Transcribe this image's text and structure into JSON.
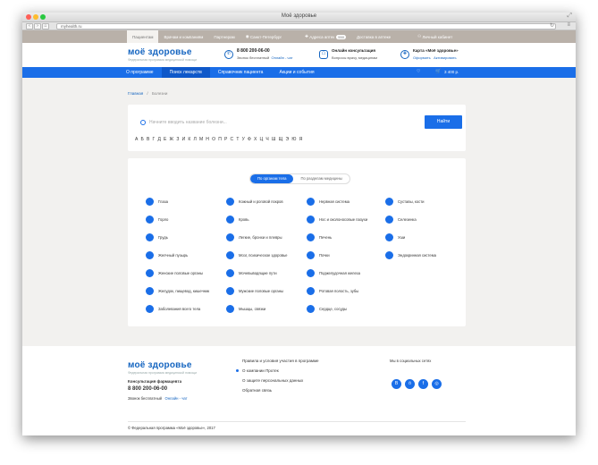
{
  "window": {
    "title": "Моё здоровье",
    "url": "myhealth.ru"
  },
  "topbar": {
    "items": [
      {
        "label": "Пациентам",
        "active": true
      },
      {
        "label": "Врачам и компаниям",
        "active": false
      },
      {
        "label": "Партнерам",
        "active": false
      },
      {
        "label": "Санкт-Петербург",
        "active": false
      },
      {
        "label": "Адреса аптек",
        "active": false,
        "badge": "550"
      },
      {
        "label": "Доставка в аптеке",
        "active": false
      },
      {
        "label": "Личный кабинет",
        "active": false
      }
    ]
  },
  "header": {
    "logo": "моё здоровье",
    "logo_sub": "Федеральная программа медицинской помощи",
    "phone": "8 800 200-06-00",
    "phone_note": "Звонок бесплатный",
    "phone_chat": "Онлайн - чат",
    "consult_title": "Онлайн консультация",
    "consult_sub": "Вопросы врачу, медицинам",
    "card_title": "Карта «Моё здоровье»",
    "card_link1": "Оформить",
    "card_link2": "Активировать"
  },
  "nav": {
    "items": [
      {
        "label": "О программе",
        "active": false
      },
      {
        "label": "Поиск лекарств",
        "active": true
      },
      {
        "label": "Справочник пациента",
        "active": false
      },
      {
        "label": "Акции и события",
        "active": false
      }
    ],
    "cart_total": "3 400 р."
  },
  "breadcrumb": {
    "home": "Главная",
    "current": "Болезни"
  },
  "search": {
    "placeholder": "Начните вводить название болезни...",
    "button": "Найти",
    "letters": [
      "А",
      "Б",
      "В",
      "Г",
      "Д",
      "Е",
      "Ж",
      "З",
      "И",
      "К",
      "Л",
      "М",
      "Н",
      "О",
      "П",
      "Р",
      "С",
      "Т",
      "У",
      "Ф",
      "Х",
      "Ц",
      "Ч",
      "Ш",
      "Щ",
      "Э",
      "Ю",
      "Я"
    ]
  },
  "tabs": {
    "organs": "По органам тела",
    "sections": "По разделам медицины"
  },
  "organs": [
    {
      "label": "Глаза",
      "icon": "eye-icon"
    },
    {
      "label": "Кожный и роговой покров",
      "icon": "skin-icon"
    },
    {
      "label": "Нервная система",
      "icon": "nerve-icon"
    },
    {
      "label": "Суставы, кости",
      "icon": "bone-icon"
    },
    {
      "label": "Горло",
      "icon": "throat-icon"
    },
    {
      "label": "Кровь",
      "icon": "blood-drop-icon"
    },
    {
      "label": "Нос и околоносовые пазухи",
      "icon": "nose-icon"
    },
    {
      "label": "Селезенка",
      "icon": "spleen-icon"
    },
    {
      "label": "Грудь",
      "icon": "chest-icon"
    },
    {
      "label": "Легкие, бронхи и плевры",
      "icon": "lungs-icon"
    },
    {
      "label": "Печень",
      "icon": "liver-icon"
    },
    {
      "label": "Уши",
      "icon": "ear-icon"
    },
    {
      "label": "Желчный пузырь",
      "icon": "gallbladder-icon"
    },
    {
      "label": "Мозг, психическое здоровье",
      "icon": "brain-icon"
    },
    {
      "label": "Почки",
      "icon": "kidney-icon"
    },
    {
      "label": "Эндокринная система",
      "icon": "endocrine-icon"
    },
    {
      "label": "Женские половые органы",
      "icon": "female-icon"
    },
    {
      "label": "Мочевыводящие пути",
      "icon": "urinary-icon"
    },
    {
      "label": "Поджелудочная железа",
      "icon": "pancreas-icon"
    },
    {
      "label": "",
      "icon": ""
    },
    {
      "label": "Желудок, пищевод, кишечник",
      "icon": "stomach-icon"
    },
    {
      "label": "Мужские половые органы",
      "icon": "male-icon"
    },
    {
      "label": "Ротовая полость, зубы",
      "icon": "mouth-icon"
    },
    {
      "label": "",
      "icon": ""
    },
    {
      "label": "Заболевания всего тела",
      "icon": "body-icon"
    },
    {
      "label": "Мышцы, связки",
      "icon": "muscle-icon"
    },
    {
      "label": "Сердце, сосуды",
      "icon": "heart-icon"
    },
    {
      "label": "",
      "icon": ""
    }
  ],
  "footer": {
    "logo": "моё здоровье",
    "logo_sub": "Федеральная программа медицинской помощи",
    "consult_label": "Консультация фармацевта",
    "phone": "8 800 200-06-00",
    "phone_note": "Звонок бесплатный",
    "chat": "Онлайн - чат",
    "links": [
      "Правила и условия участия в программе",
      "О компании Протек",
      "О защите персональных данных",
      "Обратная связь"
    ],
    "social_title": "Мы в социальных сетях",
    "social": [
      "vk-icon",
      "ok-icon",
      "facebook-icon",
      "instagram-icon"
    ],
    "copyright": "© Федеральная программа «Моё здоровье», 2017"
  },
  "colors": {
    "brand_blue": "#1a6ee8",
    "top_strip": "#b9b1a9",
    "background": "#f2f1ef"
  }
}
